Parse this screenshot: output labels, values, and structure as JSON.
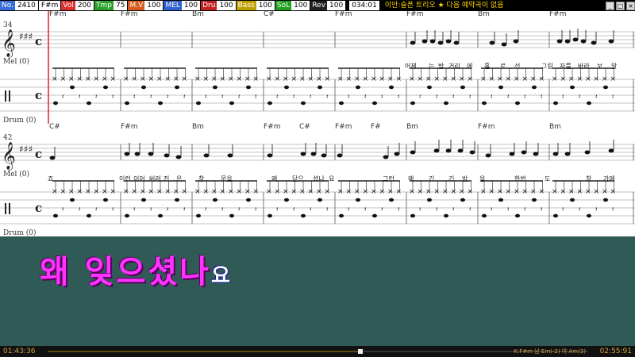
{
  "toolbar": {
    "fields": [
      {
        "label": "No.",
        "value": "2410",
        "color": "#3a6fd8"
      },
      {
        "label": "",
        "value": "F#m",
        "color": "#000"
      },
      {
        "label": "Vol",
        "value": "200",
        "color": "#d83030"
      },
      {
        "label": "Tmp",
        "value": "75",
        "color": "#2aa02a"
      },
      {
        "label": "M.V",
        "value": "100",
        "color": "#d85a20"
      },
      {
        "label": "MEL",
        "value": "100",
        "color": "#3060d0"
      },
      {
        "label": "Dru",
        "value": "100",
        "color": "#c02020"
      },
      {
        "label": "Bass",
        "value": "100",
        "color": "#c0a000"
      },
      {
        "label": "SoL",
        "value": "100",
        "color": "#20a020"
      },
      {
        "label": "Rev",
        "value": "100",
        "color": "#222"
      }
    ],
    "counter": "034:01",
    "info": "이안:슬픈 트리오 ★ 다음 예약곡이 없음"
  },
  "score": {
    "row1": {
      "measure_number": "34",
      "chords": [
        "F#m",
        "F#m",
        "Bm",
        "C#",
        "F#m",
        "F#m",
        "Bm",
        "F#m"
      ],
      "mel_label": "Mel (0)",
      "drum_label": "Drum (0)",
      "lyrics": [
        "어제",
        "는",
        "밤",
        "거리",
        "에",
        "홀",
        "로",
        "선",
        "그림",
        "자를",
        "바라",
        "보",
        "알"
      ]
    },
    "row2": {
      "measure_number": "42",
      "chords": [
        "C#",
        "F#m",
        "Bm",
        "F#m",
        "C#",
        "F#m",
        "F#",
        "Bm",
        "F#m",
        "Bm"
      ],
      "mel_label": "Mel (0)",
      "drum_label": "Drum (0)",
      "lyrics": [
        "죠",
        "이런",
        "이어",
        "버려",
        "진",
        "은",
        "창",
        "문을",
        "왜",
        "닫으",
        "셨나",
        "요",
        "그런",
        "왜",
        "긴",
        "긴",
        "밤",
        "을",
        "한번",
        "도",
        "창",
        "가에"
      ]
    }
  },
  "lyric_display": {
    "sung": "왜 잊으셨나",
    "unsung": "요"
  },
  "status": {
    "elapsed": "01:43:36",
    "progress": 0.58,
    "info": "K:F#m 남 Em(-2) 여 Am(3)",
    "total": "02:55:91"
  }
}
